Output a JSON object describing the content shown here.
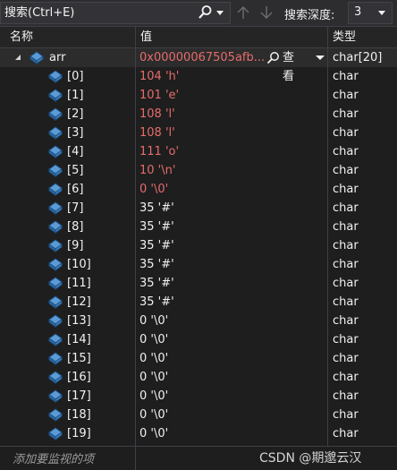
{
  "search": {
    "placeholder": "搜索(Ctrl+E)",
    "depth_label": "搜索深度:",
    "depth_value": "3"
  },
  "columns": {
    "name": "名称",
    "value": "值",
    "type": "类型"
  },
  "root": {
    "name": "arr",
    "value": "0x00000067505afb...",
    "viewer_label": "查看",
    "type": "char[20]"
  },
  "elements": [
    {
      "name": "[0]",
      "value": "104 'h'",
      "type": "char"
    },
    {
      "name": "[1]",
      "value": "101 'e'",
      "type": "char"
    },
    {
      "name": "[2]",
      "value": "108 'l'",
      "type": "char"
    },
    {
      "name": "[3]",
      "value": "108 'l'",
      "type": "char"
    },
    {
      "name": "[4]",
      "value": "111 'o'",
      "type": "char"
    },
    {
      "name": "[5]",
      "value": "10 '\\n'",
      "type": "char"
    },
    {
      "name": "[6]",
      "value": "0 '\\0'",
      "type": "char"
    },
    {
      "name": "[7]",
      "value": "35 '#'",
      "type": "char"
    },
    {
      "name": "[8]",
      "value": "35 '#'",
      "type": "char"
    },
    {
      "name": "[9]",
      "value": "35 '#'",
      "type": "char"
    },
    {
      "name": "[10]",
      "value": "35 '#'",
      "type": "char"
    },
    {
      "name": "[11]",
      "value": "35 '#'",
      "type": "char"
    },
    {
      "name": "[12]",
      "value": "35 '#'",
      "type": "char"
    },
    {
      "name": "[13]",
      "value": "0 '\\0'",
      "type": "char"
    },
    {
      "name": "[14]",
      "value": "0 '\\0'",
      "type": "char"
    },
    {
      "name": "[15]",
      "value": "0 '\\0'",
      "type": "char"
    },
    {
      "name": "[16]",
      "value": "0 '\\0'",
      "type": "char"
    },
    {
      "name": "[17]",
      "value": "0 '\\0'",
      "type": "char"
    },
    {
      "name": "[18]",
      "value": "0 '\\0'",
      "type": "char"
    },
    {
      "name": "[19]",
      "value": "0 '\\0'",
      "type": "char"
    }
  ],
  "changed_value_color": "#e66c6c",
  "plain_value_color": "#f1f1f1",
  "changed_rows": [
    0,
    1,
    2,
    3,
    4,
    5,
    6
  ],
  "footer": {
    "add_watch": "添加要监视的项",
    "watermark": "CSDN @期邈云汉"
  },
  "icons": {
    "search": "search-icon",
    "up": "arrow-up-icon",
    "down": "arrow-down-icon",
    "variable": "object-variable-icon",
    "expand": "expand-triangle-icon",
    "magnifier": "magnifier-icon"
  }
}
